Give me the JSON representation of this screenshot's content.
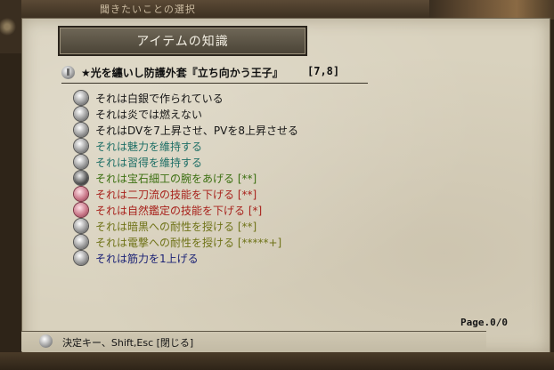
{
  "background": {
    "top_text": "　聞きたいことの選択"
  },
  "dialog": {
    "title": "アイテムの知識",
    "item_name": "★光を纏いし防護外套『立ち向かう王子』",
    "item_level": "[7,8]",
    "lines": [
      {
        "text": "それは白銀で作られている",
        "color": "black",
        "icon": "silver-orb-icon"
      },
      {
        "text": "それは炎では燃えない",
        "color": "black",
        "icon": "silver-orb-icon"
      },
      {
        "text": "それはDVを7上昇させ、PVを8上昇させる",
        "color": "black",
        "icon": "armor-icon"
      },
      {
        "text": "それは魅力を維持する",
        "color": "teal",
        "icon": "shield-icon"
      },
      {
        "text": "それは習得を維持する",
        "color": "teal",
        "icon": "shield-icon"
      },
      {
        "text": "それは宝石細工の腕をあげる [**]",
        "color": "green",
        "icon": "skill-icon"
      },
      {
        "text": "それは二刀流の技能を下げる [**]",
        "color": "red",
        "icon": "curse-icon"
      },
      {
        "text": "それは自然鑑定の技能を下げる [*]",
        "color": "red",
        "icon": "curse-icon"
      },
      {
        "text": "それは暗黒への耐性を授ける [**]",
        "color": "olive",
        "icon": "resist-orb-icon"
      },
      {
        "text": "それは電撃への耐性を授ける [*****+]",
        "color": "olive",
        "icon": "resist-orb-icon"
      },
      {
        "text": "それは筋力を1上げる",
        "color": "navy",
        "icon": "strength-icon"
      }
    ],
    "page": "Page.0/0",
    "footer": "決定キー、Shift,Esc [閉じる]"
  }
}
